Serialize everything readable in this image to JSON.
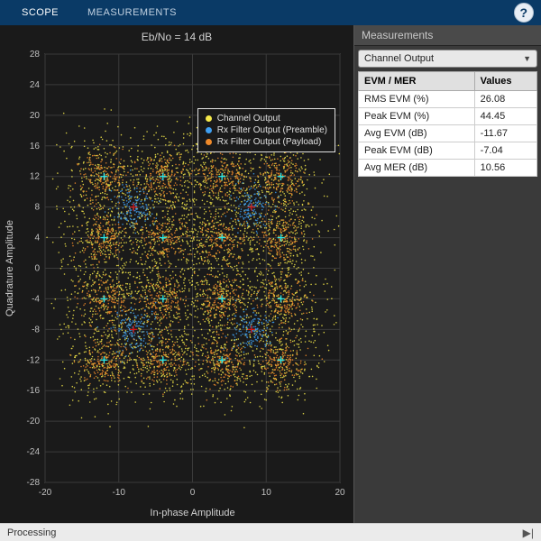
{
  "topbar": {
    "scope_label": "SCOPE",
    "measurements_label": "MEASUREMENTS"
  },
  "plot": {
    "title": "Eb/No = 14 dB",
    "xlabel": "In-phase Amplitude",
    "ylabel": "Quadrature Amplitude",
    "legend": {
      "channel": "Channel Output",
      "preamble": "Rx Filter Output (Preamble)",
      "payload": "Rx Filter Output (Payload)"
    }
  },
  "measurements": {
    "header": "Measurements",
    "select_value": "Channel Output",
    "col_metric": "EVM / MER",
    "col_value": "Values",
    "rows": [
      {
        "metric": "RMS EVM (%)",
        "value": "26.08"
      },
      {
        "metric": "Peak EVM (%)",
        "value": "44.45"
      },
      {
        "metric": "Avg EVM (dB)",
        "value": "-11.67"
      },
      {
        "metric": "Peak EVM (dB)",
        "value": "-7.04"
      },
      {
        "metric": "Avg MER (dB)",
        "value": "10.56"
      }
    ]
  },
  "status": {
    "text": "Processing"
  },
  "chart_data": {
    "type": "scatter",
    "title": "Eb/No = 14 dB",
    "xlabel": "In-phase Amplitude",
    "ylabel": "Quadrature Amplitude",
    "xlim": [
      -20,
      20
    ],
    "ylim": [
      -28,
      28
    ],
    "xticks": [
      -20,
      -10,
      0,
      10,
      20
    ],
    "yticks": [
      -28,
      -24,
      -20,
      -16,
      -12,
      -8,
      -4,
      0,
      4,
      8,
      12,
      16,
      20,
      24,
      28
    ],
    "grid": true,
    "legend_position": "top-right",
    "series": [
      {
        "name": "Channel Output",
        "color": "#f5e94a",
        "note": "dense noisy 16-QAM constellation cloud",
        "ideal_centers_x": [
          -12,
          -4,
          4,
          12,
          -12,
          -4,
          4,
          12,
          -12,
          -4,
          4,
          12,
          -12,
          -4,
          4,
          12
        ],
        "ideal_centers_y": [
          12,
          12,
          12,
          12,
          4,
          4,
          4,
          4,
          -4,
          -4,
          -4,
          -4,
          -12,
          -12,
          -12,
          -12
        ],
        "spread_sigma": 3.0,
        "approx_points": 4000
      },
      {
        "name": "Rx Filter Output (Preamble)",
        "color": "#3f9ff0",
        "note": "QPSK-like clusters near four inner diagonals",
        "ideal_centers_x": [
          -8,
          8,
          -8,
          8
        ],
        "ideal_centers_y": [
          8,
          8,
          -8,
          -8
        ],
        "spread_sigma": 1.4,
        "approx_points": 600
      },
      {
        "name": "Rx Filter Output (Payload)",
        "color": "#f08a2a",
        "note": "16-QAM filtered constellation",
        "ideal_centers_x": [
          -12,
          -4,
          4,
          12,
          -12,
          -4,
          4,
          12,
          -12,
          -4,
          4,
          12,
          -12,
          -4,
          4,
          12
        ],
        "ideal_centers_y": [
          12,
          12,
          12,
          12,
          4,
          4,
          4,
          4,
          -4,
          -4,
          -4,
          -4,
          -12,
          -12,
          -12,
          -12
        ],
        "spread_sigma": 1.6,
        "approx_points": 2500
      }
    ],
    "reference_markers": {
      "cyan_cross_16qam": {
        "color": "#2be8e8",
        "x": [
          -12,
          -4,
          4,
          12,
          -12,
          -4,
          4,
          12,
          -12,
          -4,
          4,
          12,
          -12,
          -4,
          4,
          12
        ],
        "y": [
          12,
          12,
          12,
          12,
          4,
          4,
          4,
          4,
          -4,
          -4,
          -4,
          -4,
          -12,
          -12,
          -12,
          -12
        ]
      },
      "red_cross_qpsk": {
        "color": "#d01818",
        "x": [
          -8,
          8,
          -8,
          8
        ],
        "y": [
          8,
          8,
          -8,
          -8
        ]
      }
    }
  }
}
